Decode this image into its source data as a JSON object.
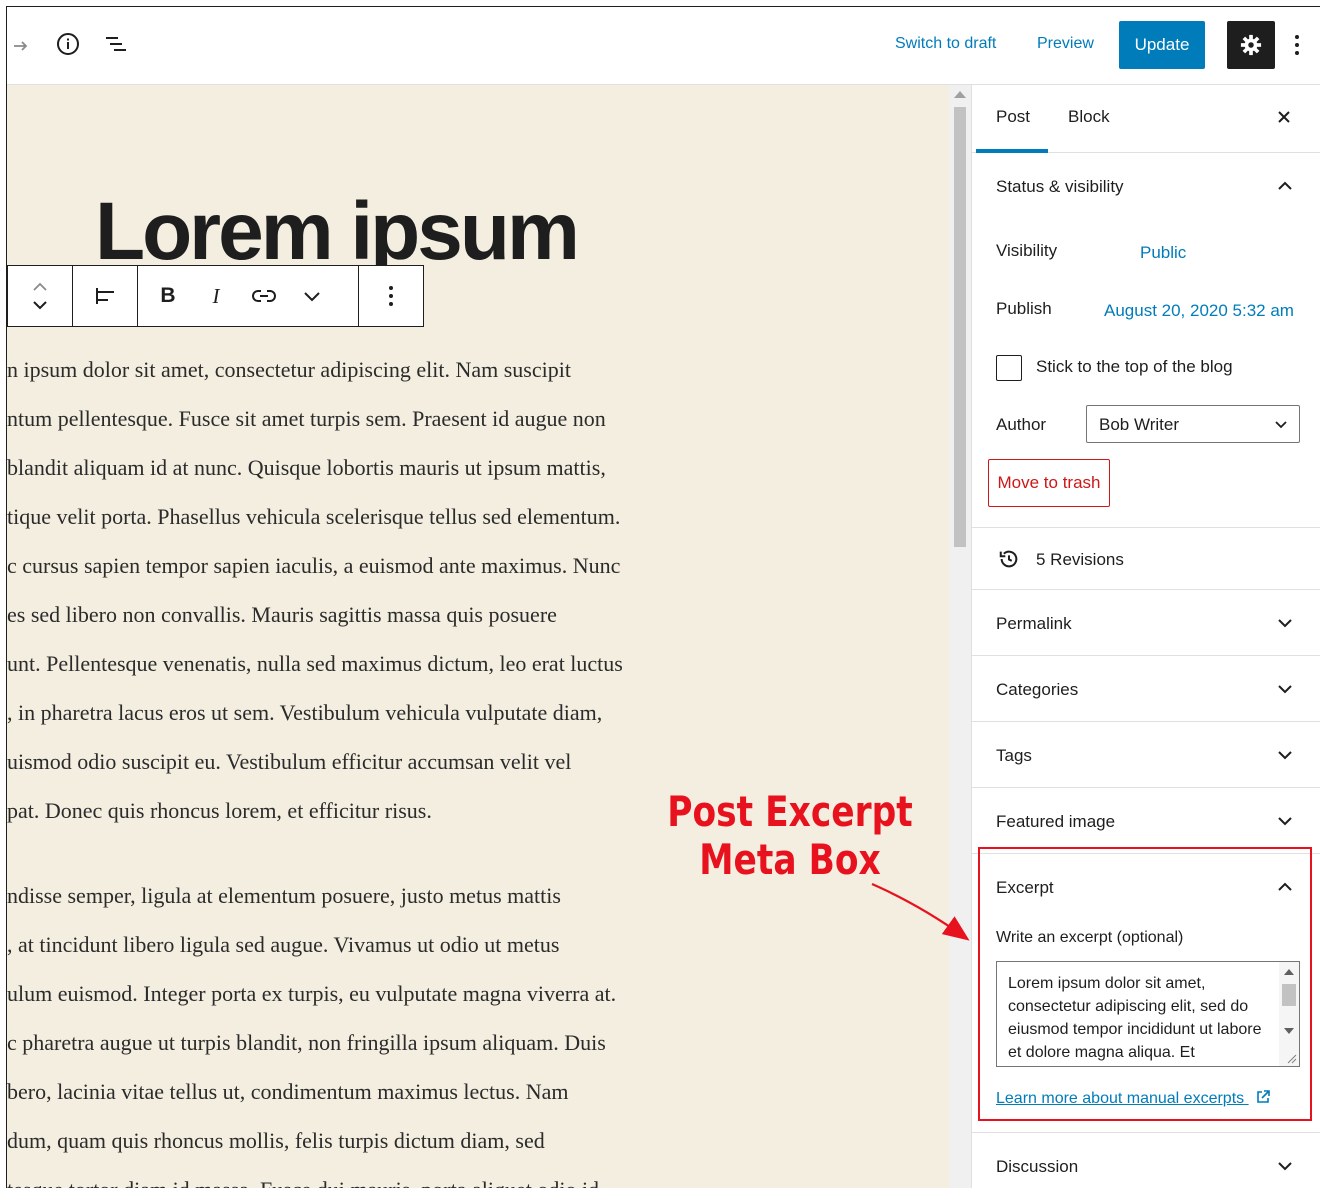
{
  "toolbar": {
    "redo_icon": "redo-icon",
    "info_icon": "info-icon",
    "outline_icon": "list-view-icon",
    "switch_to_draft": "Switch to draft",
    "preview": "Preview",
    "update": "Update",
    "settings_icon": "gear-icon",
    "more_icon": "more-vertical-icon"
  },
  "editor": {
    "title": "Lorem ipsum",
    "block_toolbar": [
      "up-down-mover",
      "align",
      "bold",
      "italic",
      "link",
      "more-rich-text",
      "block-options"
    ],
    "bold_label": "B",
    "italic_label": "I",
    "paragraph1": [
      "n ipsum dolor sit amet, consectetur adipiscing elit. Nam suscipit",
      "ntum pellentesque. Fusce sit amet turpis sem. Praesent id augue non",
      "blandit aliquam id at nunc. Quisque lobortis mauris ut ipsum mattis,",
      "tique velit porta. Phasellus vehicula scelerisque tellus sed elementum.",
      "c cursus sapien tempor sapien iaculis, a euismod ante maximus. Nunc",
      "es sed libero non convallis. Mauris sagittis massa quis posuere",
      "unt. Pellentesque venenatis, nulla sed maximus dictum, leo erat luctus",
      ", in pharetra lacus eros ut sem. Vestibulum vehicula vulputate diam,",
      "uismod odio suscipit eu. Vestibulum efficitur accumsan velit vel",
      "pat. Donec quis rhoncus lorem, et efficitur risus."
    ],
    "paragraph2": [
      "ndisse semper, ligula at elementum posuere, justo metus mattis",
      ", at tincidunt libero ligula sed augue. Vivamus ut odio ut metus",
      "ulum euismod. Integer porta ex turpis, eu vulputate magna viverra at.",
      "c pharetra augue ut turpis blandit, non fringilla ipsum aliquam. Duis",
      "bero, lacinia vitae tellus ut, condimentum maximus lectus. Nam",
      "dum, quam quis rhoncus mollis, felis turpis dictum diam, sed",
      "tesque tortor diam id massa. Fusce dui mauris, porta aliquet odio id"
    ]
  },
  "sidebar": {
    "tabs": [
      "Post",
      "Block"
    ],
    "active_tab": "Post",
    "status": {
      "title": "Status & visibility",
      "visibility_label": "Visibility",
      "visibility_value": "Public",
      "publish_label": "Publish",
      "publish_value": "August 20, 2020 5:32 am",
      "sticky_label": "Stick to the top of the blog",
      "sticky_checked": false,
      "author_label": "Author",
      "author_value": "Bob Writer",
      "trash_label": "Move to trash"
    },
    "revisions": "5 Revisions",
    "panels": [
      "Permalink",
      "Categories",
      "Tags",
      "Featured image"
    ],
    "excerpt": {
      "title": "Excerpt",
      "label": "Write an excerpt (optional)",
      "value": "Lorem ipsum dolor sit amet, consectetur adipiscing elit, sed do eiusmod tempor incididunt ut labore et dolore magna aliqua. Et",
      "learn_more": "Learn more about manual excerpts"
    },
    "discussion": "Discussion"
  },
  "annotation": {
    "line1": "Post Excerpt",
    "line2": "Meta Box",
    "color": "#e8121e"
  },
  "colors": {
    "accent": "#007cba",
    "canvas": "#f3eee0",
    "danger": "#cc1818"
  }
}
